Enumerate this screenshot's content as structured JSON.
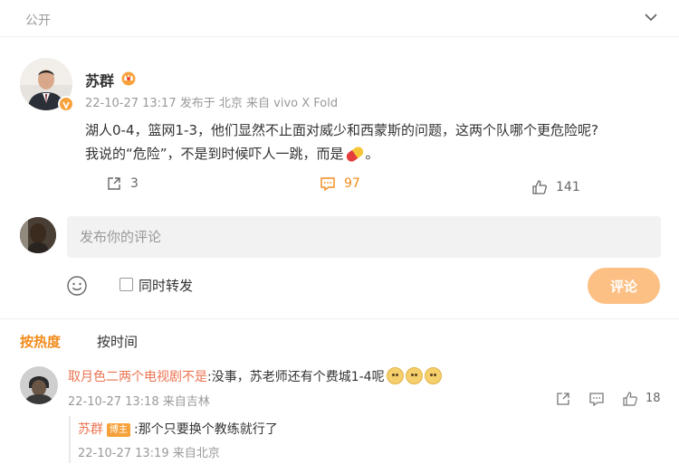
{
  "top": {
    "visibility": "公开"
  },
  "post": {
    "author": "苏群",
    "meta": "22-10-27 13:17  发布于 北京  来自 vivo X Fold",
    "line1": "湖人0-4，篮网1-3，他们显然不止面对威少和西蒙斯的问题，这两个队哪个更危险呢?",
    "line2_prefix": "我说的“危险”，不是到时候吓人一跳，而是",
    "line2_suffix": "。",
    "share_count": "3",
    "comment_count": "97",
    "like_count": "141"
  },
  "composer": {
    "placeholder": "发布你的评论",
    "repost_label": "同时转发",
    "submit_label": "评论"
  },
  "tabs": {
    "hot": "按热度",
    "time": "按时间"
  },
  "comment": {
    "author": "取月色二两个电视剧不是",
    "text": ":没事，苏老师还有个费城1-4呢",
    "meta": "22-10-27 13:18  来自吉林",
    "like_count": "18"
  },
  "reply": {
    "author": "苏群",
    "tag": "博主",
    "text": ":那个只要换个教练就行了",
    "meta": "22-10-27 13:19  来自北京"
  },
  "colors": {
    "accent": "#f28a19",
    "name_link": "#eb7350",
    "submit_bg": "#fcc085"
  }
}
